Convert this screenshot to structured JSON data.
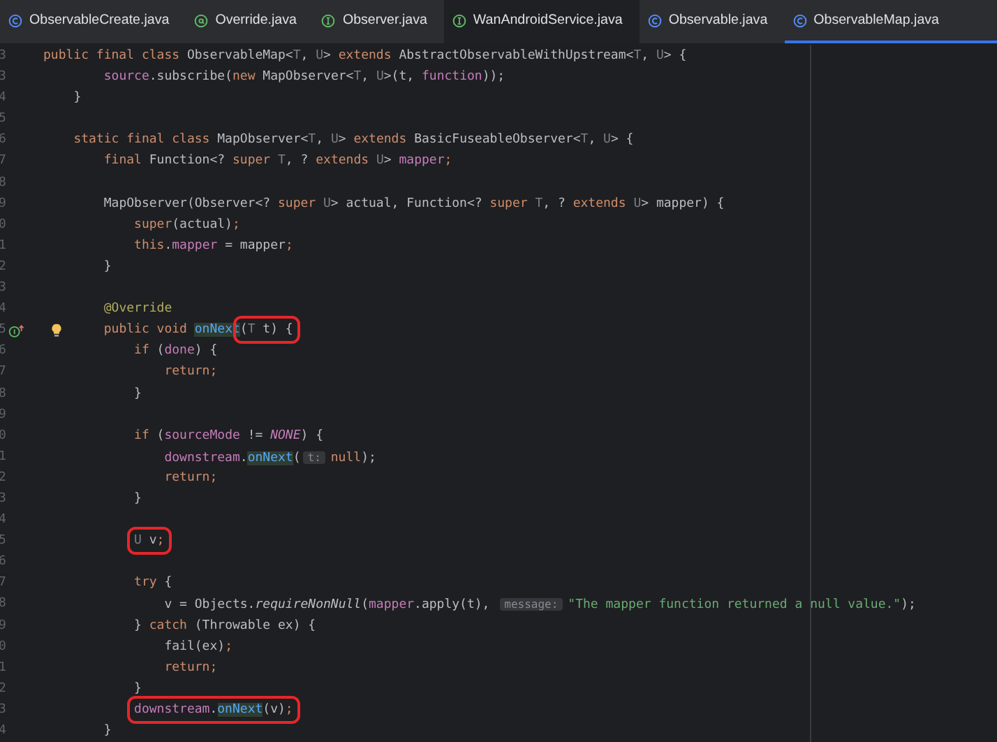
{
  "tabs": [
    {
      "label": "ObservableCreate.java",
      "kind": "class",
      "selected": false,
      "hovered": false
    },
    {
      "label": "Override.java",
      "kind": "annotation",
      "selected": false,
      "hovered": false
    },
    {
      "label": "Observer.java",
      "kind": "interface",
      "selected": false,
      "hovered": false
    },
    {
      "label": "WanAndroidService.java",
      "kind": "interface",
      "selected": false,
      "hovered": true
    },
    {
      "label": "Observable.java",
      "kind": "class",
      "selected": false,
      "hovered": false
    },
    {
      "label": "ObservableMap.java",
      "kind": "class",
      "selected": true,
      "hovered": false
    }
  ],
  "lines": [
    {
      "number": "3",
      "kind": "code",
      "tokens": [
        {
          "kind": "keyword",
          "text": "public final class "
        },
        {
          "kind": "plain",
          "text": "ObservableMap<"
        },
        {
          "kind": "type_param",
          "text": "T"
        },
        {
          "kind": "plain",
          "text": ", "
        },
        {
          "kind": "type_param",
          "text": "U"
        },
        {
          "kind": "plain",
          "text": "> "
        },
        {
          "kind": "keyword",
          "text": "extends "
        },
        {
          "kind": "plain",
          "text": "AbstractObservableWithUpstream<"
        },
        {
          "kind": "type_param",
          "text": "T"
        },
        {
          "kind": "plain",
          "text": ", "
        },
        {
          "kind": "type_param",
          "text": "U"
        },
        {
          "kind": "plain",
          "text": "> {"
        }
      ]
    },
    {
      "number": "3",
      "kind": "code",
      "tokens": [
        {
          "kind": "field",
          "text": "        source"
        },
        {
          "kind": "plain",
          "text": ".subscribe("
        },
        {
          "kind": "keyword",
          "text": "new "
        },
        {
          "kind": "plain",
          "text": "MapObserver<"
        },
        {
          "kind": "type_param",
          "text": "T"
        },
        {
          "kind": "plain",
          "text": ", "
        },
        {
          "kind": "type_param",
          "text": "U"
        },
        {
          "kind": "plain",
          "text": ">(t, "
        },
        {
          "kind": "field",
          "text": "function"
        },
        {
          "kind": "plain",
          "text": "));"
        }
      ]
    },
    {
      "number": "4",
      "kind": "code",
      "tokens": [
        {
          "kind": "plain",
          "text": "    }"
        }
      ]
    },
    {
      "number": "5",
      "kind": "code"
    },
    {
      "number": "6",
      "kind": "code",
      "tokens": [
        {
          "kind": "keyword",
          "text": "    static final class "
        },
        {
          "kind": "plain",
          "text": "MapObserver<"
        },
        {
          "kind": "type_param",
          "text": "T"
        },
        {
          "kind": "plain",
          "text": ", "
        },
        {
          "kind": "type_param",
          "text": "U"
        },
        {
          "kind": "plain",
          "text": "> "
        },
        {
          "kind": "keyword",
          "text": "extends "
        },
        {
          "kind": "plain",
          "text": "BasicFuseableObserver<"
        },
        {
          "kind": "type_param",
          "text": "T"
        },
        {
          "kind": "plain",
          "text": ", "
        },
        {
          "kind": "type_param",
          "text": "U"
        },
        {
          "kind": "plain",
          "text": "> {"
        }
      ]
    },
    {
      "number": "7",
      "kind": "code",
      "tokens": [
        {
          "kind": "keyword",
          "text": "        final "
        },
        {
          "kind": "plain",
          "text": "Function<? "
        },
        {
          "kind": "keyword",
          "text": "super "
        },
        {
          "kind": "type_param",
          "text": "T"
        },
        {
          "kind": "plain",
          "text": ", ? "
        },
        {
          "kind": "keyword",
          "text": "extends "
        },
        {
          "kind": "type_param",
          "text": "U"
        },
        {
          "kind": "plain",
          "text": "> "
        },
        {
          "kind": "field",
          "text": "mapper"
        },
        {
          "kind": "keyword",
          "text": ";"
        }
      ]
    },
    {
      "number": "8",
      "kind": "code"
    },
    {
      "number": "9",
      "kind": "code",
      "tokens": [
        {
          "kind": "plain",
          "text": "        MapObserver(Observer<? "
        },
        {
          "kind": "keyword",
          "text": "super "
        },
        {
          "kind": "type_param",
          "text": "U"
        },
        {
          "kind": "plain",
          "text": "> actual, Function<? "
        },
        {
          "kind": "keyword",
          "text": "super "
        },
        {
          "kind": "type_param",
          "text": "T"
        },
        {
          "kind": "plain",
          "text": ", ? "
        },
        {
          "kind": "keyword",
          "text": "extends "
        },
        {
          "kind": "type_param",
          "text": "U"
        },
        {
          "kind": "plain",
          "text": "> mapper) {"
        }
      ]
    },
    {
      "number": "0",
      "kind": "code",
      "tokens": [
        {
          "kind": "keyword",
          "text": "            super"
        },
        {
          "kind": "plain",
          "text": "(actual)"
        },
        {
          "kind": "keyword",
          "text": ";"
        }
      ]
    },
    {
      "number": "1",
      "kind": "code",
      "tokens": [
        {
          "kind": "keyword",
          "text": "            this"
        },
        {
          "kind": "plain",
          "text": "."
        },
        {
          "kind": "field",
          "text": "mapper"
        },
        {
          "kind": "plain",
          "text": " = mapper"
        },
        {
          "kind": "keyword",
          "text": ";"
        }
      ]
    },
    {
      "number": "2",
      "kind": "code",
      "tokens": [
        {
          "kind": "plain",
          "text": "        }"
        }
      ]
    },
    {
      "number": "3",
      "kind": "code"
    },
    {
      "number": "4",
      "kind": "code",
      "tokens": [
        {
          "kind": "annotation",
          "text": "        @Override"
        }
      ]
    },
    {
      "number": "5",
      "kind": "override",
      "tokens": [
        {
          "kind": "keyword",
          "text": "        public void "
        },
        {
          "kind": "usage",
          "text": "onNext"
        }
      ],
      "boxed": [
        {
          "kind": "plain",
          "text": "("
        },
        {
          "kind": "type_param",
          "text": "T"
        },
        {
          "kind": "plain",
          "text": " t) {"
        }
      ]
    },
    {
      "number": "6",
      "kind": "code",
      "tokens": [
        {
          "kind": "keyword",
          "text": "            if "
        },
        {
          "kind": "plain",
          "text": "("
        },
        {
          "kind": "field",
          "text": "done"
        },
        {
          "kind": "plain",
          "text": ") {"
        }
      ]
    },
    {
      "number": "7",
      "kind": "code",
      "tokens": [
        {
          "kind": "keyword",
          "text": "                return;"
        }
      ]
    },
    {
      "number": "8",
      "kind": "code",
      "tokens": [
        {
          "kind": "plain",
          "text": "            }"
        }
      ]
    },
    {
      "number": "9",
      "kind": "code"
    },
    {
      "number": "0",
      "kind": "code",
      "tokens": [
        {
          "kind": "keyword",
          "text": "            if "
        },
        {
          "kind": "plain",
          "text": "("
        },
        {
          "kind": "field",
          "text": "sourceMode"
        },
        {
          "kind": "plain",
          "text": " != "
        },
        {
          "kind": "constant",
          "text": "NONE"
        },
        {
          "kind": "plain",
          "text": ") {"
        }
      ]
    },
    {
      "number": "1",
      "kind": "code",
      "tokens": [
        {
          "kind": "field",
          "text": "                downstream"
        },
        {
          "kind": "plain",
          "text": "."
        },
        {
          "kind": "usage",
          "text": "onNext"
        },
        {
          "kind": "plain",
          "text": "("
        },
        {
          "kind": "hint",
          "text": "t:"
        },
        {
          "kind": "keyword",
          "text": "null"
        },
        {
          "kind": "plain",
          "text": ");"
        }
      ]
    },
    {
      "number": "2",
      "kind": "code",
      "tokens": [
        {
          "kind": "keyword",
          "text": "                return;"
        }
      ]
    },
    {
      "number": "3",
      "kind": "code",
      "tokens": [
        {
          "kind": "plain",
          "text": "            }"
        }
      ]
    },
    {
      "number": "4",
      "kind": "code"
    },
    {
      "number": "5",
      "kind": "code",
      "boxed": [
        {
          "kind": "type_param",
          "text": "            U"
        },
        {
          "kind": "plain",
          "text": " v"
        },
        {
          "kind": "keyword",
          "text": ";"
        }
      ]
    },
    {
      "number": "6",
      "kind": "code"
    },
    {
      "number": "7",
      "kind": "code",
      "tokens": [
        {
          "kind": "keyword",
          "text": "            try "
        },
        {
          "kind": "plain",
          "text": "{"
        }
      ]
    },
    {
      "number": "8",
      "kind": "code",
      "tokens": [
        {
          "kind": "plain",
          "text": "                v = Objects."
        },
        {
          "kind": "static_call",
          "text": "requireNonNull"
        },
        {
          "kind": "plain",
          "text": "("
        },
        {
          "kind": "field",
          "text": "mapper"
        },
        {
          "kind": "plain",
          "text": ".apply(t), "
        },
        {
          "kind": "hint",
          "text": "message:"
        },
        {
          "kind": "string",
          "text": "\"The mapper function returned a null value.\""
        },
        {
          "kind": "plain",
          "text": ");"
        }
      ]
    },
    {
      "number": "9",
      "kind": "code",
      "tokens": [
        {
          "kind": "plain",
          "text": "            } "
        },
        {
          "kind": "keyword",
          "text": "catch "
        },
        {
          "kind": "plain",
          "text": "(Throwable ex) {"
        }
      ]
    },
    {
      "number": "0",
      "kind": "code",
      "tokens": [
        {
          "kind": "plain",
          "text": "                fail(ex)"
        },
        {
          "kind": "keyword",
          "text": ";"
        }
      ]
    },
    {
      "number": "1",
      "kind": "code",
      "tokens": [
        {
          "kind": "keyword",
          "text": "                return;"
        }
      ]
    },
    {
      "number": "2",
      "kind": "code",
      "tokens": [
        {
          "kind": "plain",
          "text": "            }"
        }
      ]
    },
    {
      "number": "3",
      "kind": "code",
      "boxed": [
        {
          "kind": "field",
          "text": "            downstream"
        },
        {
          "kind": "plain",
          "text": "."
        },
        {
          "kind": "usage",
          "text": "onNext"
        },
        {
          "kind": "plain",
          "text": "(v)"
        },
        {
          "kind": "keyword",
          "text": ";"
        }
      ]
    },
    {
      "number": "4",
      "kind": "code",
      "tokens": [
        {
          "kind": "plain",
          "text": "        }"
        }
      ]
    }
  ]
}
